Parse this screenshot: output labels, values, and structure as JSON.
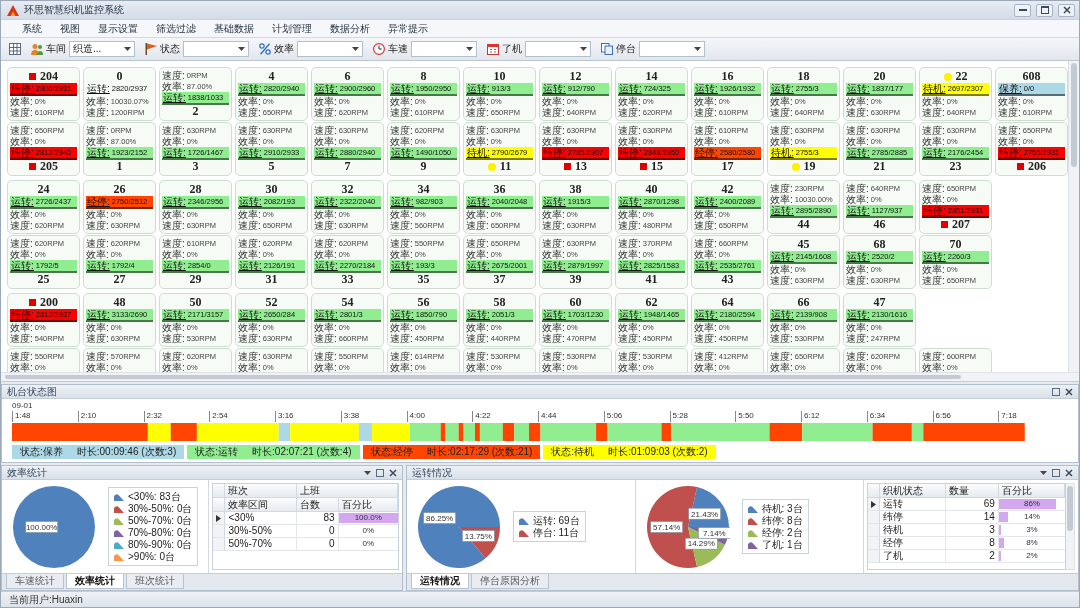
{
  "window": {
    "title": "环思智慧织机监控系统"
  },
  "menu": [
    "系统",
    "视图",
    "显示设置",
    "筛选过滤",
    "基础数据",
    "计划管理",
    "数据分析",
    "异常提示"
  ],
  "toolbar": [
    {
      "label": "车间",
      "value": "织造..."
    },
    {
      "label": "状态"
    },
    {
      "label": "效率"
    },
    {
      "label": "车速"
    },
    {
      "label": "了机"
    },
    {
      "label": "停台"
    }
  ],
  "machine_rows": [
    {
      "cards": [
        {
          "kind": "head",
          "no": "204",
          "marker": {
            "kind": "square",
            "color": "#e00000"
          },
          "status": {
            "color": "#ff0000",
            "label": "纬停:",
            "value": "2806/2931"
          },
          "lines": [
            [
              "效率:",
              "0%"
            ],
            [
              "速度:",
              "610RPM"
            ]
          ]
        },
        {
          "kind": "head",
          "no": "0",
          "status": {
            "label": "运转:",
            "value": "2820/2937"
          },
          "lines": [
            [
              "效率:",
              "10030.07%"
            ],
            [
              "速度:",
              "1200RPM"
            ]
          ]
        },
        {
          "kind": "foot",
          "no": "2",
          "status": {
            "color": "#90ee90",
            "label": "运转:",
            "value": "1838/1033"
          },
          "lines": [
            [
              "速度:",
              "0RPM"
            ],
            [
              "效率:",
              "87.00%"
            ]
          ]
        },
        {
          "kind": "head",
          "no": "4",
          "status": {
            "color": "#90ee90",
            "label": "运转:",
            "value": "2820/2940"
          },
          "lines": [
            [
              "效率:",
              "0%"
            ],
            [
              "速度:",
              "650RPM"
            ]
          ]
        },
        {
          "kind": "head",
          "no": "6",
          "status": {
            "color": "#90ee90",
            "label": "运转:",
            "value": "2900/2960"
          },
          "lines": [
            [
              "效率:",
              "0%"
            ],
            [
              "速度:",
              "620RPM"
            ]
          ]
        },
        {
          "kind": "head",
          "no": "8",
          "status": {
            "color": "#90ee90",
            "label": "运转:",
            "value": "1950/2950"
          },
          "lines": [
            [
              "效率:",
              "0%"
            ],
            [
              "速度:",
              "610RPM"
            ]
          ]
        },
        {
          "kind": "head",
          "no": "10",
          "status": {
            "color": "#90ee90",
            "label": "运转:",
            "value": "913/3"
          },
          "lines": [
            [
              "效率:",
              "0%"
            ],
            [
              "速度:",
              "650RPM"
            ]
          ]
        },
        {
          "kind": "head",
          "no": "12",
          "status": {
            "color": "#90ee90",
            "label": "运转:",
            "value": "912/790"
          },
          "lines": [
            [
              "效率:",
              "0%"
            ],
            [
              "速度:",
              "640RPM"
            ]
          ]
        },
        {
          "kind": "head",
          "no": "14",
          "status": {
            "color": "#90ee90",
            "label": "运转:",
            "value": "724/325"
          },
          "lines": [
            [
              "效率:",
              "0%"
            ],
            [
              "速度:",
              "620RPM"
            ]
          ]
        },
        {
          "kind": "head",
          "no": "16",
          "status": {
            "color": "#90ee90",
            "label": "运转:",
            "value": "1926/1932"
          },
          "lines": [
            [
              "效率:",
              "0%"
            ],
            [
              "速度:",
              "610RPM"
            ]
          ]
        },
        {
          "kind": "head",
          "no": "18",
          "status": {
            "color": "#90ee90",
            "label": "运转:",
            "value": "2755/3"
          },
          "lines": [
            [
              "效率:",
              "0%"
            ],
            [
              "速度:",
              "640RPM"
            ]
          ]
        },
        {
          "kind": "head",
          "no": "20",
          "status": {
            "color": "#90ee90",
            "label": "运转:",
            "value": "1837/177"
          },
          "lines": [
            [
              "效率:",
              "0%"
            ],
            [
              "速度:",
              "630RPM"
            ]
          ]
        },
        {
          "kind": "head",
          "no": "22",
          "marker": {
            "kind": "dot",
            "color": "#fff200"
          },
          "status": {
            "color": "#ffff00",
            "label": "待机:",
            "value": "2697/2307"
          },
          "lines": [
            [
              "效率:",
              "0%"
            ],
            [
              "速度:",
              "640RPM"
            ]
          ]
        },
        {
          "kind": "head",
          "no": "608",
          "status": {
            "color": "#add8e6",
            "label": "保养:",
            "value": "0/0"
          },
          "lines": [
            [
              "效率:",
              "0%"
            ],
            [
              "速度:",
              "610RPM"
            ]
          ]
        }
      ]
    },
    {
      "cards": [
        {
          "kind": "foot",
          "no": "205",
          "marker": {
            "kind": "square",
            "color": "#e00000"
          },
          "status": {
            "color": "#ff0000",
            "label": "纬停:",
            "value": "2812/2940"
          },
          "lines": [
            [
              "速度:",
              "650RPM"
            ],
            [
              "效率:",
              "0%"
            ]
          ]
        },
        {
          "kind": "foot",
          "no": "1",
          "status": {
            "color": "#90ee90",
            "label": "运转:",
            "value": "1923/2152"
          },
          "lines": [
            [
              "速度:",
              "0RPM"
            ],
            [
              "效率:",
              "87.00%"
            ]
          ]
        },
        {
          "kind": "foot",
          "no": "3",
          "status": {
            "color": "#90ee90",
            "label": "运转:",
            "value": "1726/1467"
          },
          "lines": [
            [
              "速度:",
              "630RPM"
            ],
            [
              "效率:",
              "0%"
            ]
          ]
        },
        {
          "kind": "foot",
          "no": "5",
          "status": {
            "color": "#90ee90",
            "label": "运转:",
            "value": "2910/2933"
          },
          "lines": [
            [
              "速度:",
              "630RPM"
            ],
            [
              "效率:",
              "0%"
            ]
          ]
        },
        {
          "kind": "foot",
          "no": "7",
          "status": {
            "color": "#90ee90",
            "label": "运转:",
            "value": "2880/2940"
          },
          "lines": [
            [
              "速度:",
              "630RPM"
            ],
            [
              "效率:",
              "0%"
            ]
          ]
        },
        {
          "kind": "foot",
          "no": "9",
          "status": {
            "color": "#90ee90",
            "label": "运转:",
            "value": "1490/1050"
          },
          "lines": [
            [
              "速度:",
              "620RPM"
            ],
            [
              "效率:",
              "0%"
            ]
          ]
        },
        {
          "kind": "foot",
          "no": "11",
          "marker": {
            "kind": "dot",
            "color": "#fff200"
          },
          "status": {
            "color": "#ffff00",
            "label": "待机:",
            "value": "2790/2679"
          },
          "lines": [
            [
              "速度:",
              "630RPM"
            ],
            [
              "效率:",
              "0%"
            ]
          ]
        },
        {
          "kind": "foot",
          "no": "13",
          "marker": {
            "kind": "square",
            "color": "#e00000"
          },
          "status": {
            "color": "#ff0000",
            "label": "纬停:",
            "value": "2785/2907"
          },
          "lines": [
            [
              "速度:",
              "630RPM"
            ],
            [
              "效率:",
              "0%"
            ]
          ]
        },
        {
          "kind": "foot",
          "no": "15",
          "marker": {
            "kind": "square",
            "color": "#e00000"
          },
          "status": {
            "color": "#ff0000",
            "label": "纬停:",
            "value": "2848/2950"
          },
          "lines": [
            [
              "速度:",
              "630RPM"
            ],
            [
              "效率:",
              "0%"
            ]
          ]
        },
        {
          "kind": "foot",
          "no": "17",
          "status": {
            "color": "#ff4500",
            "label": "经停:",
            "value": "2580/2580"
          },
          "lines": [
            [
              "速度:",
              "610RPM"
            ],
            [
              "效率:",
              "0%"
            ]
          ]
        },
        {
          "kind": "foot",
          "no": "19",
          "marker": {
            "kind": "dot",
            "color": "#fff200"
          },
          "status": {
            "color": "#ffff00",
            "label": "待机:",
            "value": "2755/3"
          },
          "lines": [
            [
              "速度:",
              "630RPM"
            ],
            [
              "效率:",
              "0%"
            ]
          ]
        },
        {
          "kind": "foot",
          "no": "21",
          "status": {
            "color": "#90ee90",
            "label": "运转:",
            "value": "2785/2885"
          },
          "lines": [
            [
              "速度:",
              "630RPM"
            ],
            [
              "效率:",
              "0%"
            ]
          ]
        },
        {
          "kind": "foot",
          "no": "23",
          "status": {
            "color": "#90ee90",
            "label": "运转:",
            "value": "2176/2454"
          },
          "lines": [
            [
              "速度:",
              "630RPM"
            ],
            [
              "效率:",
              "0%"
            ]
          ]
        },
        {
          "kind": "foot",
          "no": "206",
          "marker": {
            "kind": "square",
            "color": "#e00000"
          },
          "status": {
            "color": "#ff0000",
            "label": "纬停:",
            "value": "2755/2931"
          },
          "lines": [
            [
              "速度:",
              "650RPM"
            ],
            [
              "效率:",
              "0%"
            ]
          ]
        }
      ]
    },
    {
      "cards": [
        {
          "kind": "head",
          "no": "24",
          "status": {
            "color": "#90ee90",
            "label": "运转:",
            "value": "2726/2437"
          },
          "lines": [
            [
              "效率:",
              "0%"
            ],
            [
              "速度:",
              "620RPM"
            ]
          ]
        },
        {
          "kind": "head",
          "no": "26",
          "status": {
            "color": "#ff4500",
            "label": "经停:",
            "value": "2750/2512"
          },
          "lines": [
            [
              "效率:",
              "0%"
            ],
            [
              "速度:",
              "630RPM"
            ]
          ]
        },
        {
          "kind": "head",
          "no": "28",
          "status": {
            "color": "#90ee90",
            "label": "运转:",
            "value": "2346/2956"
          },
          "lines": [
            [
              "效率:",
              "0%"
            ],
            [
              "速度:",
              "630RPM"
            ]
          ]
        },
        {
          "kind": "head",
          "no": "30",
          "status": {
            "color": "#90ee90",
            "label": "运转:",
            "value": "2082/193"
          },
          "lines": [
            [
              "效率:",
              "0%"
            ],
            [
              "速度:",
              "650RPM"
            ]
          ]
        },
        {
          "kind": "head",
          "no": "32",
          "status": {
            "color": "#90ee90",
            "label": "运转:",
            "value": "2322/2040"
          },
          "lines": [
            [
              "效率:",
              "0%"
            ],
            [
              "速度:",
              "630RPM"
            ]
          ]
        },
        {
          "kind": "head",
          "no": "34",
          "status": {
            "color": "#90ee90",
            "label": "运转:",
            "value": "982/903"
          },
          "lines": [
            [
              "效率:",
              "0%"
            ],
            [
              "速度:",
              "560RPM"
            ]
          ]
        },
        {
          "kind": "head",
          "no": "36",
          "status": {
            "color": "#90ee90",
            "label": "运转:",
            "value": "2040/2048"
          },
          "lines": [
            [
              "效率:",
              "0%"
            ],
            [
              "速度:",
              "650RPM"
            ]
          ]
        },
        {
          "kind": "head",
          "no": "38",
          "status": {
            "color": "#90ee90",
            "label": "运转:",
            "value": "1915/3"
          },
          "lines": [
            [
              "效率:",
              "0%"
            ],
            [
              "速度:",
              "630RPM"
            ]
          ]
        },
        {
          "kind": "head",
          "no": "40",
          "status": {
            "color": "#90ee90",
            "label": "运转:",
            "value": "2870/1298"
          },
          "lines": [
            [
              "效率:",
              "0%"
            ],
            [
              "速度:",
              "480RPM"
            ]
          ]
        },
        {
          "kind": "head",
          "no": "42",
          "status": {
            "color": "#90ee90",
            "label": "运转:",
            "value": "2400/2089"
          },
          "lines": [
            [
              "效率:",
              "0%"
            ],
            [
              "速度:",
              "650RPM"
            ]
          ]
        },
        {
          "kind": "foot",
          "no": "44",
          "status": {
            "color": "#90ee90",
            "label": "运转:",
            "value": "2895/2890"
          },
          "lines": [
            [
              "速度:",
              "230RPM"
            ],
            [
              "效率:",
              "10030.00%"
            ]
          ]
        },
        {
          "kind": "foot",
          "no": "46",
          "status": {
            "color": "#90ee90",
            "label": "运转:",
            "value": "1127/937"
          },
          "lines": [
            [
              "速度:",
              "640RPM"
            ],
            [
              "效率:",
              "0%"
            ]
          ]
        },
        {
          "kind": "foot",
          "no": "207",
          "marker": {
            "kind": "square",
            "color": "#e00000"
          },
          "status": {
            "color": "#ff0000",
            "label": "纬停:",
            "value": "2851/2931"
          },
          "lines": [
            [
              "速度:",
              "650RPM"
            ],
            [
              "效率:",
              "0%"
            ]
          ]
        }
      ]
    },
    {
      "cards": [
        {
          "kind": "foot",
          "no": "25",
          "status": {
            "color": "#90ee90",
            "label": "运转:",
            "value": "1792/5"
          },
          "lines": [
            [
              "速度:",
              "620RPM"
            ],
            [
              "效率:",
              "0%"
            ]
          ]
        },
        {
          "kind": "foot",
          "no": "27",
          "status": {
            "color": "#90ee90",
            "label": "运转:",
            "value": "1792/4"
          },
          "lines": [
            [
              "速度:",
              "620RPM"
            ],
            [
              "效率:",
              "0%"
            ]
          ]
        },
        {
          "kind": "foot",
          "no": "29",
          "status": {
            "color": "#90ee90",
            "label": "运转:",
            "value": "2854/0"
          },
          "lines": [
            [
              "速度:",
              "610RPM"
            ],
            [
              "效率:",
              "0%"
            ]
          ]
        },
        {
          "kind": "foot",
          "no": "31",
          "status": {
            "color": "#90ee90",
            "label": "运转:",
            "value": "2126/191"
          },
          "lines": [
            [
              "速度:",
              "620RPM"
            ],
            [
              "效率:",
              "0%"
            ]
          ]
        },
        {
          "kind": "foot",
          "no": "33",
          "status": {
            "color": "#90ee90",
            "label": "运转:",
            "value": "2270/2184"
          },
          "lines": [
            [
              "速度:",
              "620RPM"
            ],
            [
              "效率:",
              "0%"
            ]
          ]
        },
        {
          "kind": "foot",
          "no": "35",
          "status": {
            "color": "#90ee90",
            "label": "运转:",
            "value": "193/3"
          },
          "lines": [
            [
              "速度:",
              "550RPM"
            ],
            [
              "效率:",
              "0%"
            ]
          ]
        },
        {
          "kind": "foot",
          "no": "37",
          "status": {
            "color": "#90ee90",
            "label": "运转:",
            "value": "2675/2001"
          },
          "lines": [
            [
              "速度:",
              "650RPM"
            ],
            [
              "效率:",
              "0%"
            ]
          ]
        },
        {
          "kind": "foot",
          "no": "39",
          "status": {
            "color": "#90ee90",
            "label": "运转:",
            "value": "2879/1997"
          },
          "lines": [
            [
              "速度:",
              "630RPM"
            ],
            [
              "效率:",
              "0%"
            ]
          ]
        },
        {
          "kind": "foot",
          "no": "41",
          "status": {
            "color": "#90ee90",
            "label": "运转:",
            "value": "2825/1583"
          },
          "lines": [
            [
              "速度:",
              "370RPM"
            ],
            [
              "效率:",
              "0%"
            ]
          ]
        },
        {
          "kind": "foot",
          "no": "43",
          "status": {
            "color": "#90ee90",
            "label": "运转:",
            "value": "2535/2761"
          },
          "lines": [
            [
              "速度:",
              "660RPM"
            ],
            [
              "效率:",
              "0%"
            ]
          ]
        },
        {
          "kind": "head",
          "no": "45",
          "status": {
            "color": "#90ee90",
            "label": "运转:",
            "value": "2145/1608"
          },
          "lines": [
            [
              "效率:",
              "0%"
            ],
            [
              "速度:",
              "630RPM"
            ]
          ]
        },
        {
          "kind": "head",
          "no": "68",
          "status": {
            "color": "#90ee90",
            "label": "运转:",
            "value": "2520/2"
          },
          "lines": [
            [
              "效率:",
              "0%"
            ],
            [
              "速度:",
              "630RPM"
            ]
          ]
        },
        {
          "kind": "head",
          "no": "70",
          "status": {
            "color": "#90ee90",
            "label": "运转:",
            "value": "2260/3"
          },
          "lines": [
            [
              "效率:",
              "0%"
            ],
            [
              "速度:",
              "650RPM"
            ]
          ]
        }
      ]
    },
    {
      "cards": [
        {
          "kind": "head",
          "no": "200",
          "marker": {
            "kind": "square",
            "color": "#e00000"
          },
          "status": {
            "color": "#ff0000",
            "label": "纬停:",
            "value": "2812/2937"
          },
          "lines": [
            [
              "效率:",
              "0%"
            ],
            [
              "速度:",
              "540RPM"
            ]
          ]
        },
        {
          "kind": "head",
          "no": "48",
          "status": {
            "color": "#90ee90",
            "label": "运转:",
            "value": "3133/2690"
          },
          "lines": [
            [
              "效率:",
              "0%"
            ],
            [
              "速度:",
              "630RPM"
            ]
          ]
        },
        {
          "kind": "head",
          "no": "50",
          "status": {
            "color": "#90ee90",
            "label": "运转:",
            "value": "2171/3157"
          },
          "lines": [
            [
              "效率:",
              "0%"
            ],
            [
              "速度:",
              "530RPM"
            ]
          ]
        },
        {
          "kind": "head",
          "no": "52",
          "status": {
            "color": "#90ee90",
            "label": "运转:",
            "value": "2650/284"
          },
          "lines": [
            [
              "效率:",
              "0%"
            ],
            [
              "速度:",
              "630RPM"
            ]
          ]
        },
        {
          "kind": "head",
          "no": "54",
          "status": {
            "color": "#90ee90",
            "label": "运转:",
            "value": "2801/3"
          },
          "lines": [
            [
              "效率:",
              "0%"
            ],
            [
              "速度:",
              "660RPM"
            ]
          ]
        },
        {
          "kind": "head",
          "no": "56",
          "status": {
            "color": "#90ee90",
            "label": "运转:",
            "value": "1850/790"
          },
          "lines": [
            [
              "效率:",
              "0%"
            ],
            [
              "速度:",
              "450RPM"
            ]
          ]
        },
        {
          "kind": "head",
          "no": "58",
          "status": {
            "color": "#90ee90",
            "label": "运转:",
            "value": "2051/3"
          },
          "lines": [
            [
              "效率:",
              "0%"
            ],
            [
              "速度:",
              "440RPM"
            ]
          ]
        },
        {
          "kind": "head",
          "no": "60",
          "status": {
            "color": "#90ee90",
            "label": "运转:",
            "value": "1703/1230"
          },
          "lines": [
            [
              "效率:",
              "0%"
            ],
            [
              "速度:",
              "470RPM"
            ]
          ]
        },
        {
          "kind": "head",
          "no": "62",
          "status": {
            "color": "#90ee90",
            "label": "运转:",
            "value": "1948/1465"
          },
          "lines": [
            [
              "效率:",
              "0%"
            ],
            [
              "速度:",
              "450RPM"
            ]
          ]
        },
        {
          "kind": "head",
          "no": "64",
          "status": {
            "color": "#90ee90",
            "label": "运转:",
            "value": "2180/2594"
          },
          "lines": [
            [
              "效率:",
              "0%"
            ],
            [
              "速度:",
              "450RPM"
            ]
          ]
        },
        {
          "kind": "head",
          "no": "66",
          "status": {
            "color": "#90ee90",
            "label": "运转:",
            "value": "2139/908"
          },
          "lines": [
            [
              "效率:",
              "0%"
            ],
            [
              "速度:",
              "530RPM"
            ]
          ]
        },
        {
          "kind": "head",
          "no": "47",
          "status": {
            "color": "#90ee90",
            "label": "运转:",
            "value": "2130/1616"
          },
          "lines": [
            [
              "效率:",
              "0%"
            ],
            [
              "速度:",
              "247RPM"
            ]
          ]
        }
      ]
    },
    {
      "cards": [
        {
          "kind": "foot",
          "lines": [
            [
              "速度:",
              "550RPM"
            ],
            [
              "效率:",
              "0%"
            ]
          ]
        },
        {
          "kind": "foot",
          "lines": [
            [
              "速度:",
              "570RPM"
            ],
            [
              "效率:",
              "0%"
            ]
          ]
        },
        {
          "kind": "foot",
          "lines": [
            [
              "速度:",
              "620RPM"
            ],
            [
              "效率:",
              "0%"
            ]
          ]
        },
        {
          "kind": "foot",
          "lines": [
            [
              "速度:",
              "630RPM"
            ],
            [
              "效率:",
              "0%"
            ]
          ]
        },
        {
          "kind": "foot",
          "lines": [
            [
              "速度:",
              "550RPM"
            ],
            [
              "效率:",
              "0%"
            ]
          ]
        },
        {
          "kind": "foot",
          "lines": [
            [
              "速度:",
              "614RPM"
            ],
            [
              "效率:",
              "0%"
            ]
          ]
        },
        {
          "kind": "foot",
          "lines": [
            [
              "速度:",
              "530RPM"
            ],
            [
              "效率:",
              "0%"
            ]
          ]
        },
        {
          "kind": "foot",
          "lines": [
            [
              "速度:",
              "530RPM"
            ],
            [
              "效率:",
              "0%"
            ]
          ]
        },
        {
          "kind": "foot",
          "lines": [
            [
              "速度:",
              "530RPM"
            ],
            [
              "效率:",
              "0%"
            ]
          ]
        },
        {
          "kind": "foot",
          "lines": [
            [
              "速度:",
              "412RPM"
            ],
            [
              "效率:",
              "0%"
            ]
          ]
        },
        {
          "kind": "foot",
          "lines": [
            [
              "速度:",
              "650RPM"
            ],
            [
              "效率:",
              "0%"
            ]
          ]
        },
        {
          "kind": "foot",
          "lines": [
            [
              "速度:",
              "620RPM"
            ],
            [
              "效率:",
              "0%"
            ]
          ]
        },
        {
          "kind": "foot",
          "lines": [
            [
              "速度:",
              "600RPM"
            ],
            [
              "效率:",
              "0%"
            ]
          ]
        }
      ]
    }
  ],
  "timeline": {
    "title": "机台状态图",
    "date": "09-01",
    "ticks": [
      "1:48",
      "2:10",
      "2:32",
      "2:54",
      "3:16",
      "3:38",
      "4:00",
      "4:22",
      "4:44",
      "5:06",
      "5:28",
      "5:50",
      "6:12",
      "6:34",
      "6:56",
      "7:18"
    ],
    "legend": [
      {
        "color": "#add8e6",
        "status": "状态:保养",
        "detail": "时长:00:09:46 (次数:3)"
      },
      {
        "color": "#90ee90",
        "status": "状态:运转",
        "detail": "时长:02:07:21 (次数:4)"
      },
      {
        "color": "#ff4500",
        "status": "状态:经停",
        "detail": "时长:02:17:29 (次数:21)"
      },
      {
        "color": "#ffff00",
        "status": "状态:待机",
        "detail": "时长:01:09:03 (次数:2)"
      }
    ]
  },
  "efficiency_panel": {
    "title": "效率统计",
    "chart_data": [
      {
        "type": "pie",
        "categories": [
          "<30%: 83台",
          "30%-50%: 0台",
          "50%-70%: 0台",
          "70%-80%: 0台",
          "80%-90%: 0台",
          ">90%: 0台"
        ],
        "values": [
          100,
          0,
          0,
          0,
          0,
          0
        ],
        "colors": [
          "#4f81bd",
          "#c0504d",
          "#9bbb59",
          "#8064a2",
          "#4bacc6",
          "#f79646"
        ],
        "value_labels": [
          "100.00%",
          null,
          null,
          null,
          null,
          null
        ],
        "legend": "right"
      }
    ],
    "table": {
      "group_row": [
        "班次",
        "上班"
      ],
      "columns": [
        "效率区间",
        "台数",
        "百分比"
      ],
      "rows": [
        {
          "selected": true,
          "cells": [
            "<30%",
            "83",
            "100.0%"
          ],
          "level": 1
        },
        {
          "selected": false,
          "cells": [
            "30%-50%",
            "0",
            "0%"
          ]
        },
        {
          "selected": false,
          "cells": [
            "50%-70%",
            "0",
            "0%"
          ]
        }
      ]
    },
    "tabs": [
      {
        "label": "车速统计",
        "selected": false
      },
      {
        "label": "效率统计",
        "selected": true
      },
      {
        "label": "班次统计",
        "selected": false
      }
    ]
  },
  "status_panel": {
    "title": "运转情况",
    "chart_data": [
      {
        "type": "pie",
        "categories": [
          "运转: 69台",
          "停台: 11台"
        ],
        "values": [
          86.25,
          13.75
        ],
        "colors": [
          "#4f81bd",
          "#c0504d"
        ],
        "value_labels": [
          "86.25%",
          "13.75%"
        ],
        "legend": "right"
      },
      {
        "type": "pie",
        "categories": [
          "待机: 3台",
          "纬停: 8台",
          "经停: 2台",
          "了机: 1台"
        ],
        "values": [
          21.43,
          57.14,
          14.29,
          7.14
        ],
        "colors": [
          "#4f81bd",
          "#c0504d",
          "#9bbb59",
          "#8064a2"
        ],
        "value_labels": [
          "21.43%",
          "57.14%",
          "14.29%",
          "7.14%"
        ],
        "legend": "right"
      }
    ],
    "table": {
      "columns": [
        "织机状态",
        "数量",
        "百分比"
      ],
      "rows": [
        {
          "selected": true,
          "cells": [
            "运转",
            "69",
            "86%"
          ],
          "level": 0.86
        },
        {
          "selected": false,
          "cells": [
            "纬停",
            "14",
            "14%"
          ],
          "level": 0.14
        },
        {
          "selected": false,
          "cells": [
            "待机",
            "3",
            "3%"
          ],
          "level": 0.03
        },
        {
          "selected": false,
          "cells": [
            "经停",
            "8",
            "8%"
          ],
          "level": 0.08
        },
        {
          "selected": false,
          "cells": [
            "了机",
            "2",
            "2%"
          ],
          "level": 0.02
        }
      ]
    },
    "tabs": [
      {
        "label": "运转情况",
        "selected": true
      },
      {
        "label": "停台原因分析",
        "selected": false
      }
    ]
  },
  "status_bar": "当前用户:Huaxin"
}
